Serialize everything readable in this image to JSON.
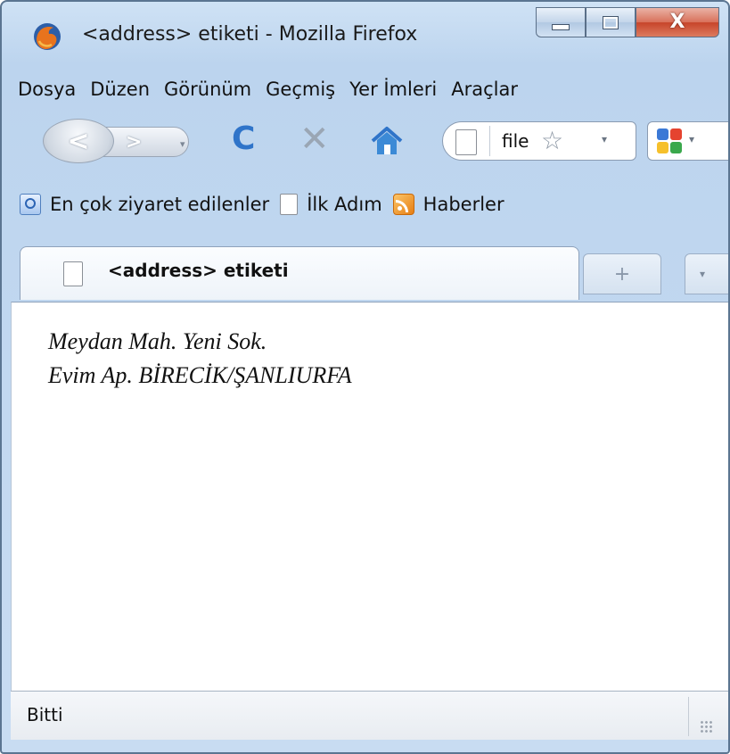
{
  "window": {
    "title": "<address> etiketi - Mozilla Firefox",
    "app_icon": "firefox-icon",
    "controls": {
      "minimize": "minimize-icon",
      "maximize": "maximize-icon",
      "close": "close-icon",
      "close_glyph": "X"
    }
  },
  "menu": [
    "Dosya",
    "Düzen",
    "Görünüm",
    "Geçmiş",
    "Yer İmleri",
    "Araçlar"
  ],
  "navigation": {
    "back_glyph": "<",
    "forward_glyph": ">",
    "dropdown_glyph": "▾",
    "reload_glyph": "C",
    "stop_glyph": "✕",
    "url_text": "file",
    "bookmark_star": "☆",
    "search_engine": "google-icon",
    "colors": {
      "reload": "#2f74c9",
      "home": "#2f74c9"
    }
  },
  "bookmarks": [
    {
      "label": "En çok ziyaret edilenler",
      "icon": "most-visited-icon"
    },
    {
      "label": "İlk Adım",
      "icon": "page-icon"
    },
    {
      "label": "Haberler",
      "icon": "rss-icon"
    }
  ],
  "tabs": [
    {
      "label": "<address> etiketi",
      "icon": "page-icon"
    }
  ],
  "tab_controls": {
    "new_tab": "+",
    "list_all": "▾"
  },
  "content": {
    "address_lines": [
      "Meydan Mah. Yeni Sok.",
      "Evim Ap. BİRECİK/ŞANLIURFA"
    ]
  },
  "status": {
    "text": "Bitti"
  }
}
